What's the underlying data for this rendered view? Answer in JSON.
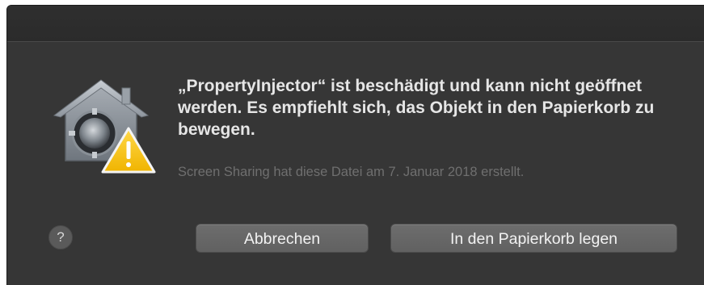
{
  "dialog": {
    "message": "„PropertyInjector“ ist beschädigt und kann nicht geöffnet werden. Es empfiehlt sich, das Objekt in den Papierkorb zu bewegen.",
    "info": "Screen Sharing hat diese Datei am 7. Januar 2018 erstellt.",
    "help_label": "?",
    "buttons": {
      "cancel": "Abbrechen",
      "move_to_trash": "In den Papierkorb legen"
    }
  },
  "icons": {
    "app_icon": "gatekeeper-house-icon",
    "badge": "warning-triangle-icon",
    "help": "help-icon"
  },
  "colors": {
    "dialog_background": "#363636",
    "message_text": "#e6e6e6",
    "info_text": "#6f6f6f",
    "button_background": "#666666",
    "warning_yellow": "#f6c300"
  }
}
